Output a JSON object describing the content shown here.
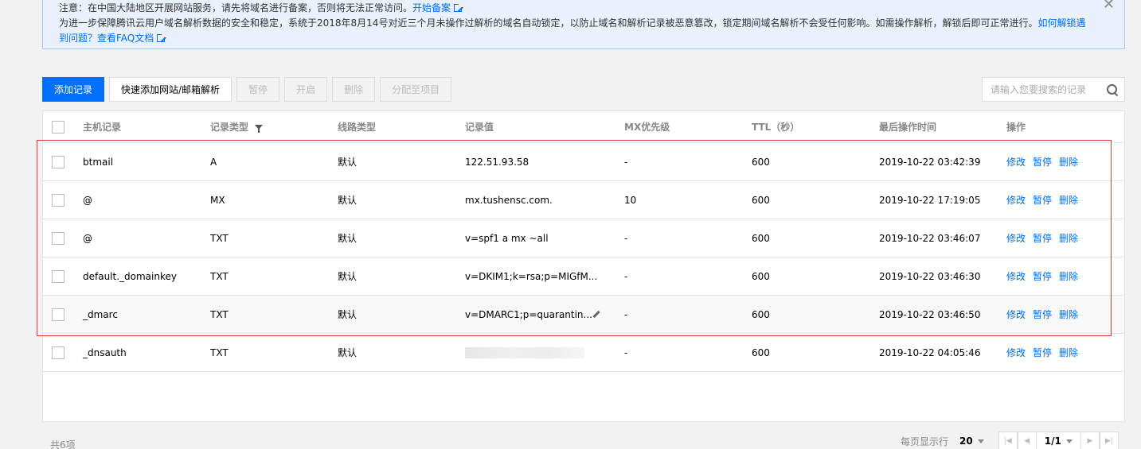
{
  "notice": {
    "line1": "注意：在中国大陆地区开展网站服务，请先将域名进行备案，否则将无法正常访问。",
    "line1_link": "开始备案",
    "line2": "为进一步保障腾讯云用户域名解析数据的安全和稳定，系统于2018年8月14号对近三个月未操作过解析的域名自动锁定，以防止域名和解析记录被恶意篡改，锁定期间域名解析不会受任何影响。如需操作解析，解锁后即可正常进行。",
    "line2_link": "如何解锁遇到问题？查看FAQ文档",
    "close_label": "✕",
    "close_icon": "close-icon",
    "link_icon": "external-link-icon"
  },
  "toolbar": {
    "add_label": "添加记录",
    "quick_add_label": "快速添加网站/邮箱解析",
    "pause_label": "暂停",
    "enable_label": "开启",
    "delete_label": "删除",
    "assign_label": "分配至项目"
  },
  "search": {
    "placeholder": "请输入您要搜索的记录",
    "icon": "search-icon"
  },
  "table": {
    "headers": {
      "host": "主机记录",
      "type": "记录类型",
      "line": "线路类型",
      "value": "记录值",
      "mx": "MX优先级",
      "ttl": "TTL（秒）",
      "time": "最后操作时间",
      "ops": "操作"
    },
    "rows": [
      {
        "host": "btmail",
        "type": "A",
        "line": "默认",
        "value": "122.51.93.58",
        "mx": "-",
        "ttl": "600",
        "time": "2019-10-22 03:42:39"
      },
      {
        "host": "@",
        "type": "MX",
        "line": "默认",
        "value": "mx.tushensc.com.",
        "mx": "10",
        "ttl": "600",
        "time": "2019-10-22 17:19:05"
      },
      {
        "host": "@",
        "type": "TXT",
        "line": "默认",
        "value": "v=spf1 a mx ~all",
        "mx": "-",
        "ttl": "600",
        "time": "2019-10-22 03:46:07"
      },
      {
        "host": "default._domainkey",
        "type": "TXT",
        "line": "默认",
        "value": "v=DKIM1;k=rsa;p=MIGfM...",
        "mx": "-",
        "ttl": "600",
        "time": "2019-10-22 03:46:30"
      },
      {
        "host": "_dmarc",
        "type": "TXT",
        "line": "默认",
        "value": "v=DMARC1;p=quarantin...",
        "mx": "-",
        "ttl": "600",
        "time": "2019-10-22 03:46:50"
      },
      {
        "host": "_dnsauth",
        "type": "TXT",
        "line": "默认",
        "value": "",
        "mx": "-",
        "ttl": "600",
        "time": "2019-10-22 04:05:46"
      }
    ],
    "op_edit": "修改",
    "op_pause": "暂停",
    "op_delete": "删除"
  },
  "footer": {
    "total": "共6项",
    "per_page_label": "每页显示行",
    "per_page": "20",
    "page": "1/1"
  },
  "colors": {
    "accent": "#006eff",
    "annotation": "#e03a3a"
  }
}
